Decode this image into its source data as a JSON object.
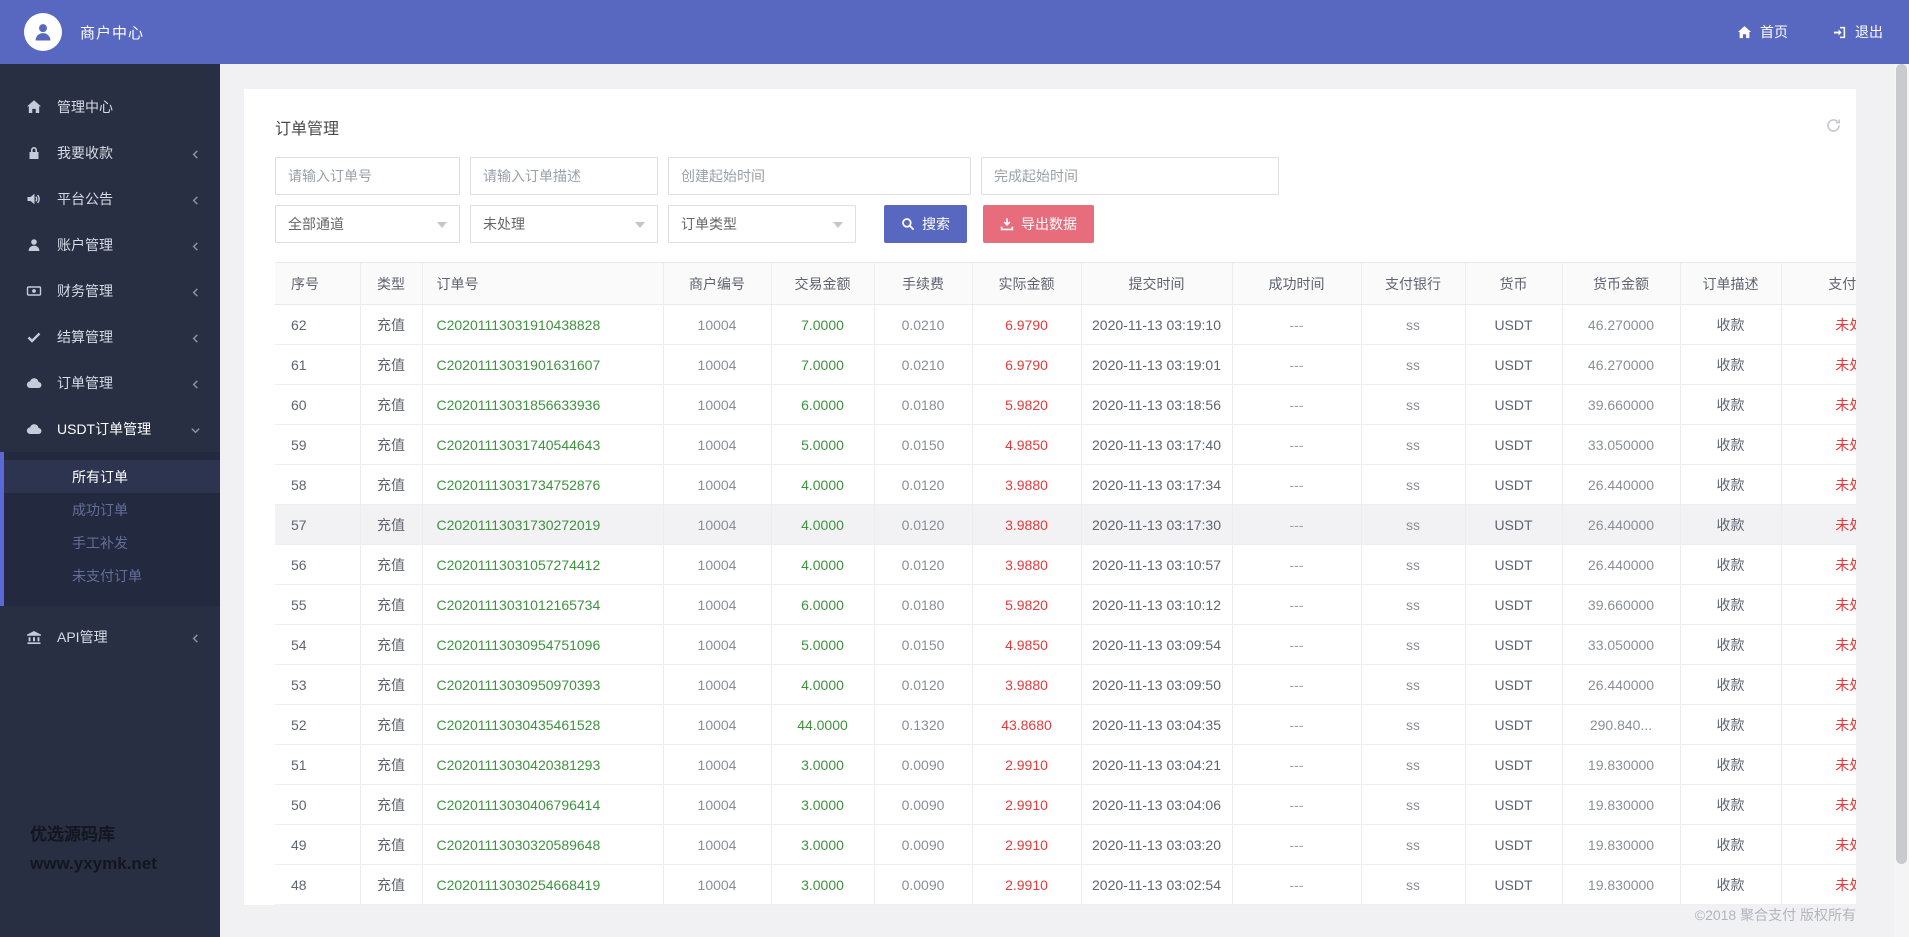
{
  "colors": {
    "accent": "#5867c0",
    "export": "#e76d7c",
    "green": "#3f9140",
    "red": "#e23b3b",
    "sidebar": "#282f42",
    "submenu": "#232a3f"
  },
  "header": {
    "brand": "商户中心",
    "nav": [
      {
        "label": "首页"
      },
      {
        "label": "退出"
      }
    ]
  },
  "sidebar": {
    "items": [
      {
        "label": "管理中心",
        "icon": "home-icon"
      },
      {
        "label": "我要收款",
        "icon": "lock-icon"
      },
      {
        "label": "平台公告",
        "icon": "speaker-icon"
      },
      {
        "label": "账户管理",
        "icon": "user-icon"
      },
      {
        "label": "财务管理",
        "icon": "money-icon"
      },
      {
        "label": "结算管理",
        "icon": "check-icon"
      },
      {
        "label": "订单管理",
        "icon": "cloud-icon"
      },
      {
        "label": "USDT订单管理",
        "icon": "cloud-icon",
        "expanded": true,
        "children": [
          {
            "label": "所有订单",
            "active": true
          },
          {
            "label": "成功订单"
          },
          {
            "label": "手工补发"
          },
          {
            "label": "未支付订单"
          }
        ]
      },
      {
        "label": "API管理",
        "icon": "bank-icon"
      }
    ],
    "watermark": {
      "line1": "优选源码库",
      "line2": "www.yxymk.net"
    }
  },
  "panel": {
    "title": "订单管理",
    "filters": {
      "inputs": [
        "请输入订单号",
        "请输入订单描述",
        "创建起始时间",
        "完成起始时间"
      ],
      "selects": [
        "全部通道",
        "未处理",
        "订单类型"
      ],
      "search_label": "搜索",
      "export_label": "导出数据"
    },
    "table": {
      "columns": [
        "序号",
        "类型",
        "订单号",
        "商户编号",
        "交易金额",
        "手续费",
        "实际金额",
        "提交时间",
        "成功时间",
        "支付银行",
        "货币",
        "货币金额",
        "订单描述",
        "支付状态"
      ],
      "highlight_index": 5,
      "rows": [
        [
          "62",
          "充值",
          "C20201113031910438828",
          "10004",
          "7.0000",
          "0.0210",
          "6.9790",
          "2020-11-13 03:19:10",
          "---",
          "ss",
          "USDT",
          "46.270000",
          "收款",
          "未处理"
        ],
        [
          "61",
          "充值",
          "C20201113031901631607",
          "10004",
          "7.0000",
          "0.0210",
          "6.9790",
          "2020-11-13 03:19:01",
          "---",
          "ss",
          "USDT",
          "46.270000",
          "收款",
          "未处理"
        ],
        [
          "60",
          "充值",
          "C20201113031856633936",
          "10004",
          "6.0000",
          "0.0180",
          "5.9820",
          "2020-11-13 03:18:56",
          "---",
          "ss",
          "USDT",
          "39.660000",
          "收款",
          "未处理"
        ],
        [
          "59",
          "充值",
          "C20201113031740544643",
          "10004",
          "5.0000",
          "0.0150",
          "4.9850",
          "2020-11-13 03:17:40",
          "---",
          "ss",
          "USDT",
          "33.050000",
          "收款",
          "未处理"
        ],
        [
          "58",
          "充值",
          "C20201113031734752876",
          "10004",
          "4.0000",
          "0.0120",
          "3.9880",
          "2020-11-13 03:17:34",
          "---",
          "ss",
          "USDT",
          "26.440000",
          "收款",
          "未处理"
        ],
        [
          "57",
          "充值",
          "C20201113031730272019",
          "10004",
          "4.0000",
          "0.0120",
          "3.9880",
          "2020-11-13 03:17:30",
          "---",
          "ss",
          "USDT",
          "26.440000",
          "收款",
          "未处理"
        ],
        [
          "56",
          "充值",
          "C20201113031057274412",
          "10004",
          "4.0000",
          "0.0120",
          "3.9880",
          "2020-11-13 03:10:57",
          "---",
          "ss",
          "USDT",
          "26.440000",
          "收款",
          "未处理"
        ],
        [
          "55",
          "充值",
          "C20201113031012165734",
          "10004",
          "6.0000",
          "0.0180",
          "5.9820",
          "2020-11-13 03:10:12",
          "---",
          "ss",
          "USDT",
          "39.660000",
          "收款",
          "未处理"
        ],
        [
          "54",
          "充值",
          "C20201113030954751096",
          "10004",
          "5.0000",
          "0.0150",
          "4.9850",
          "2020-11-13 03:09:54",
          "---",
          "ss",
          "USDT",
          "33.050000",
          "收款",
          "未处理"
        ],
        [
          "53",
          "充值",
          "C20201113030950970393",
          "10004",
          "4.0000",
          "0.0120",
          "3.9880",
          "2020-11-13 03:09:50",
          "---",
          "ss",
          "USDT",
          "26.440000",
          "收款",
          "未处理"
        ],
        [
          "52",
          "充值",
          "C20201113030435461528",
          "10004",
          "44.0000",
          "0.1320",
          "43.8680",
          "2020-11-13 03:04:35",
          "---",
          "ss",
          "USDT",
          "290.840...",
          "收款",
          "未处理"
        ],
        [
          "51",
          "充值",
          "C20201113030420381293",
          "10004",
          "3.0000",
          "0.0090",
          "2.9910",
          "2020-11-13 03:04:21",
          "---",
          "ss",
          "USDT",
          "19.830000",
          "收款",
          "未处理"
        ],
        [
          "50",
          "充值",
          "C20201113030406796414",
          "10004",
          "3.0000",
          "0.0090",
          "2.9910",
          "2020-11-13 03:04:06",
          "---",
          "ss",
          "USDT",
          "19.830000",
          "收款",
          "未处理"
        ],
        [
          "49",
          "充值",
          "C20201113030320589648",
          "10004",
          "3.0000",
          "0.0090",
          "2.9910",
          "2020-11-13 03:03:20",
          "---",
          "ss",
          "USDT",
          "19.830000",
          "收款",
          "未处理"
        ],
        [
          "48",
          "充值",
          "C20201113030254668419",
          "10004",
          "3.0000",
          "0.0090",
          "2.9910",
          "2020-11-13 03:02:54",
          "---",
          "ss",
          "USDT",
          "19.830000",
          "收款",
          "未处理"
        ]
      ]
    }
  },
  "footer": {
    "copyright": "©2018 聚合支付 版权所有"
  }
}
